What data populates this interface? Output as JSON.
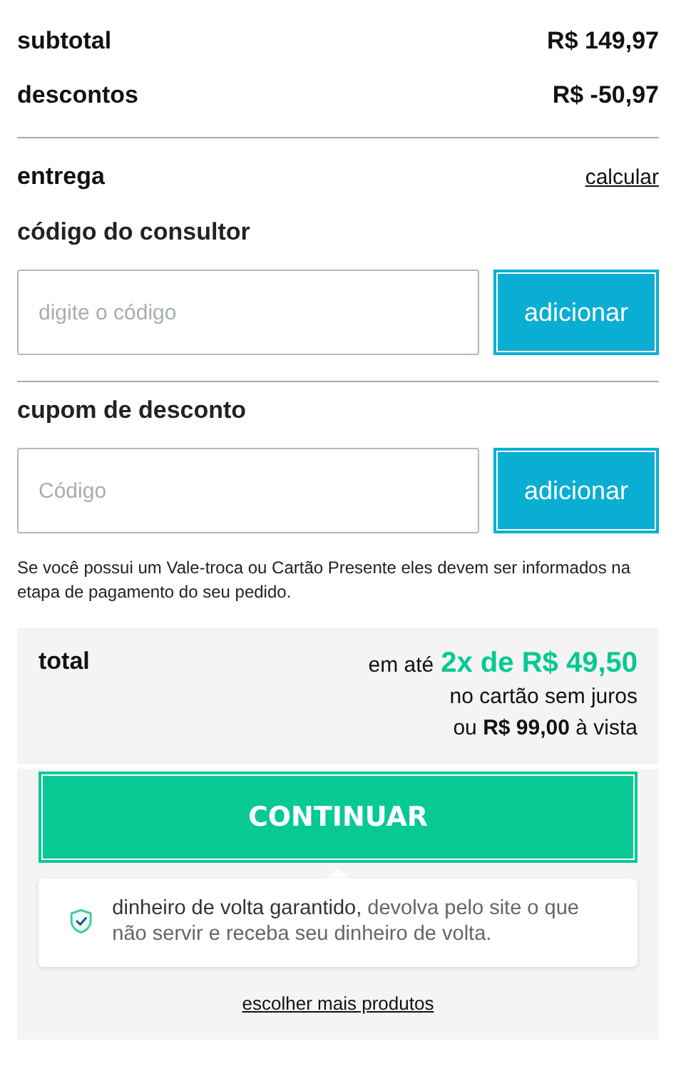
{
  "summary": [
    {
      "label": "subtotal",
      "value": "R$ 149,97"
    },
    {
      "label": "descontos",
      "value": "R$ -50,97"
    }
  ],
  "delivery": {
    "label": "entrega",
    "link": "calcular"
  },
  "consultant": {
    "title": "código do consultor",
    "placeholder": "digite o código",
    "button": "adicionar"
  },
  "coupon": {
    "title": "cupom de desconto",
    "placeholder": "Código",
    "button": "adicionar"
  },
  "note": "Se você possui um Vale-troca ou Cartão Presente eles devem ser informados na etapa de pagamento do seu pedido.",
  "total": {
    "label": "total",
    "prefix": "em até",
    "installment": "2x de R$ 49,50",
    "terms": "no cartão sem juros",
    "cash": "ou **R$ 99,00** à vista"
  },
  "continue_button": "CONTINUAR",
  "guarantee": "**dinheiro de volta garantido,** devolva pelo site o que não servir e receba seu dinheiro de volta.",
  "more_link": "escolher mais produtos"
}
